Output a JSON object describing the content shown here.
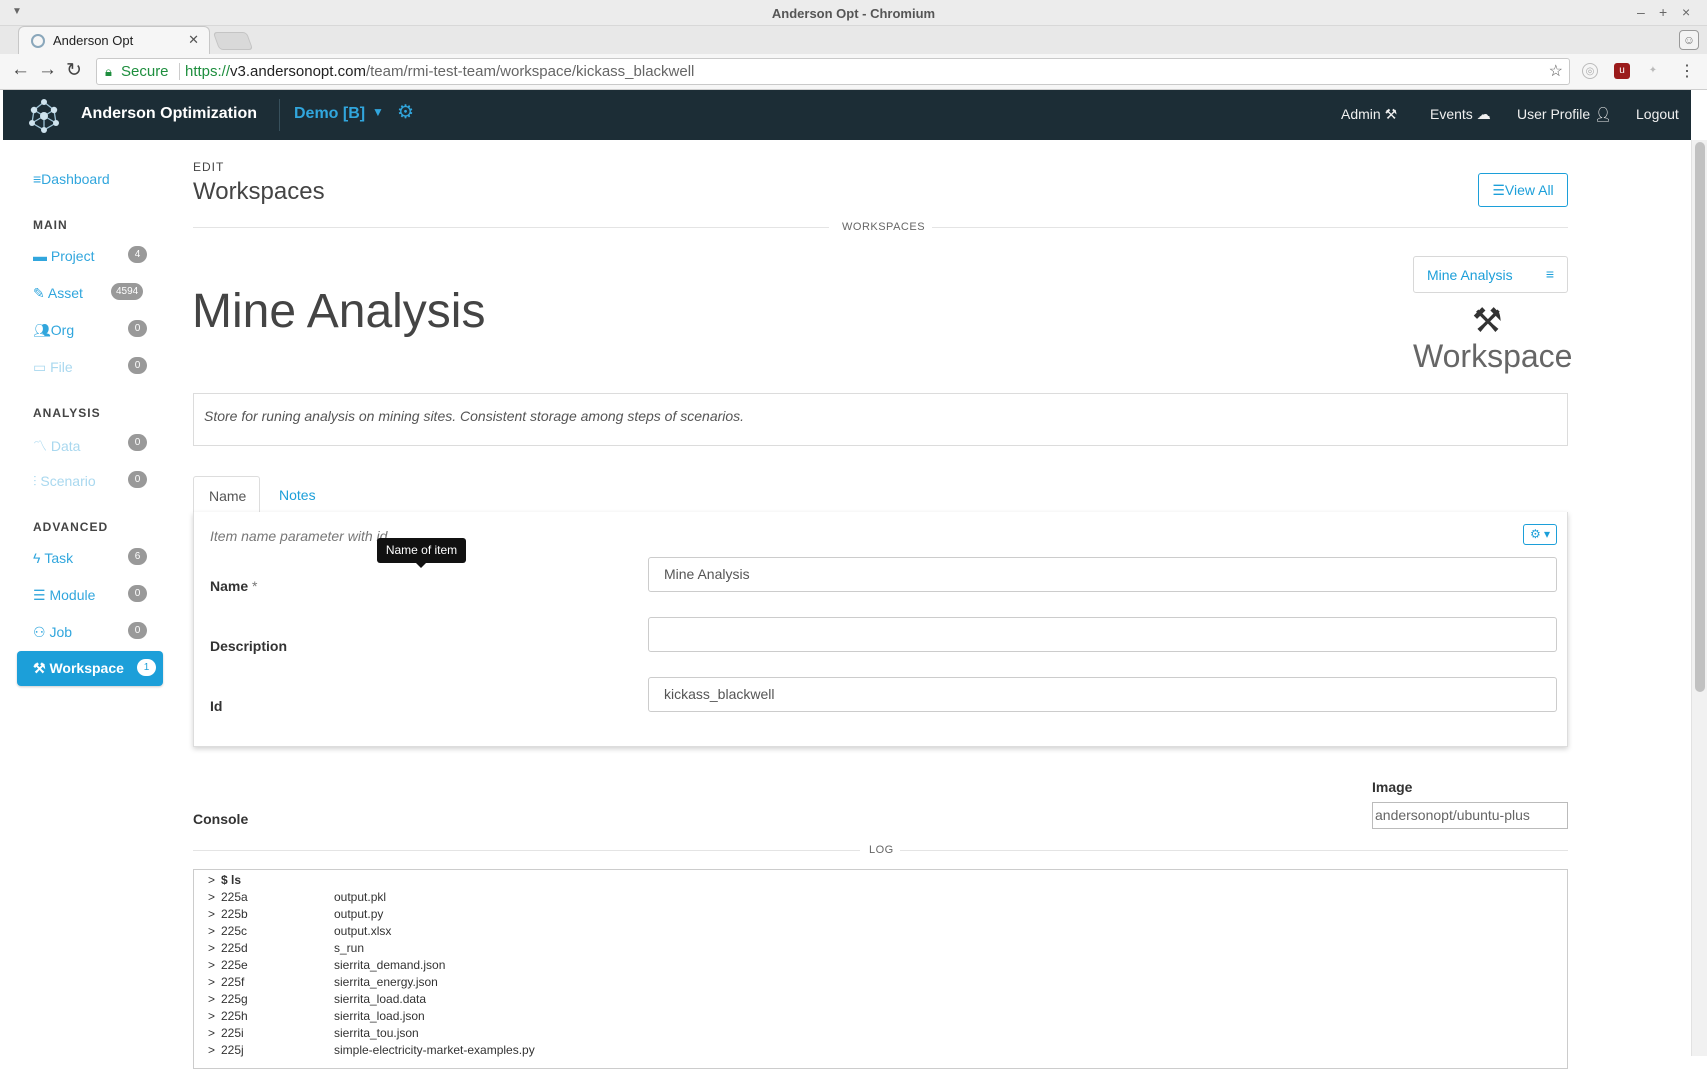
{
  "window": {
    "title": "Anderson Opt - Chromium"
  },
  "browser": {
    "tab_title": "Anderson Opt",
    "secure_label": "Secure",
    "url_scheme": "https://",
    "url_host": "v3.andersonopt.com",
    "url_path": "/team/rmi-test-team/workspace/kickass_blackwell"
  },
  "navbar": {
    "brand": "Anderson Optimization",
    "team": "Demo [B]",
    "links": {
      "admin": "Admin",
      "events": "Events",
      "profile": "User Profile",
      "logout": "Logout"
    }
  },
  "sidebar": {
    "dashboard": "Dashboard",
    "sections": {
      "main": "MAIN",
      "analysis": "ANALYSIS",
      "advanced": "ADVANCED"
    },
    "main_items": [
      {
        "label": "Project",
        "count": "4"
      },
      {
        "label": "Asset",
        "count": "4594"
      },
      {
        "label": "Org",
        "count": "0"
      },
      {
        "label": "File",
        "count": "0"
      }
    ],
    "analysis_items": [
      {
        "label": "Data",
        "count": "0"
      },
      {
        "label": "Scenario",
        "count": "0"
      }
    ],
    "advanced_items": [
      {
        "label": "Task",
        "count": "6"
      },
      {
        "label": "Module",
        "count": "0"
      },
      {
        "label": "Job",
        "count": "0"
      }
    ],
    "active_item": {
      "label": "Workspace",
      "count": "1"
    }
  },
  "page": {
    "edit_label": "EDIT",
    "heading": "Workspaces",
    "view_all": "View All",
    "section_divider": "WORKSPACES",
    "selector_label": "Mine Analysis",
    "title": "Mine Analysis",
    "type_label": "Workspace",
    "description": "Store for runing analysis on mining sites. Consistent storage among steps of scenarios."
  },
  "tabs": {
    "name": "Name",
    "notes": "Notes"
  },
  "form": {
    "hint": "Item name parameter with id",
    "tooltip": "Name of item",
    "fields": {
      "name_label": "Name",
      "name_required": "*",
      "name_value": "Mine Analysis",
      "description_label": "Description",
      "description_value": "",
      "id_label": "Id",
      "id_value": "kickass_blackwell"
    }
  },
  "console": {
    "label": "Console",
    "image_label": "Image",
    "image_value": "andersonopt/ubuntu-plus",
    "log_divider": "LOG",
    "lines": [
      {
        "key": "$ ls",
        "value": ""
      },
      {
        "key": "225a",
        "value": "output.pkl"
      },
      {
        "key": "225b",
        "value": "output.py"
      },
      {
        "key": "225c",
        "value": "output.xlsx"
      },
      {
        "key": "225d",
        "value": "s_run"
      },
      {
        "key": "225e",
        "value": "sierrita_demand.json"
      },
      {
        "key": "225f",
        "value": "sierrita_energy.json"
      },
      {
        "key": "225g",
        "value": "sierrita_load.data"
      },
      {
        "key": "225h",
        "value": "sierrita_load.json"
      },
      {
        "key": "225i",
        "value": "sierrita_tou.json"
      },
      {
        "key": "225j",
        "value": "simple-electricity-market-examples.py"
      }
    ]
  },
  "colors": {
    "accent": "#1c9fd9",
    "navbar": "#1c2d36",
    "secure": "#1e8e3e"
  }
}
